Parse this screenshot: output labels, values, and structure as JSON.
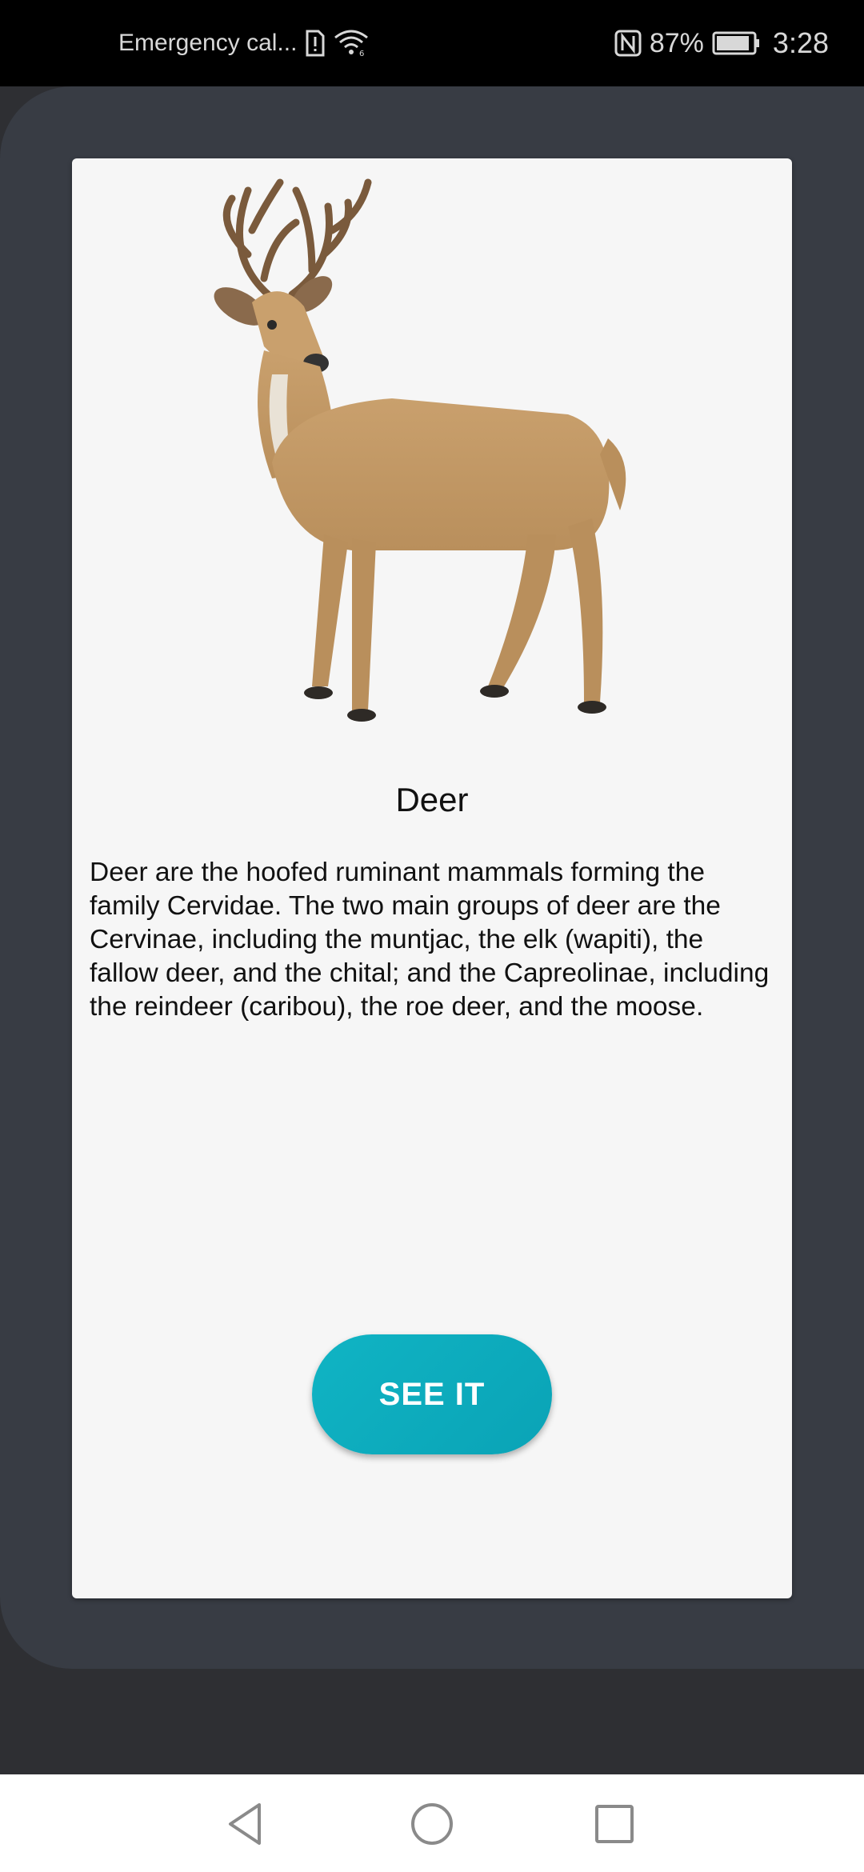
{
  "status_bar": {
    "carrier_text": "Emergency cal...",
    "battery_percent": "87%",
    "time": "3:28",
    "icons": [
      "sim-alert-icon",
      "wifi-icon",
      "nfc-icon",
      "battery-icon"
    ]
  },
  "card": {
    "image_alt": "deer-image",
    "title": "Deer",
    "description": "Deer are the hoofed ruminant mammals forming the family Cervidae. The two main groups of deer are the Cervinae, including the muntjac, the elk (wapiti), the fallow deer, and the chital; and the Capreolinae, including the reindeer (caribou), the roe deer, and the moose.",
    "button_label": "SEE IT"
  },
  "nav_bar": {
    "icons": [
      "back-icon",
      "home-icon",
      "recents-icon"
    ]
  },
  "colors": {
    "accent": "#0aa8bb",
    "panel": "#383c44",
    "card": "#f6f6f6"
  }
}
